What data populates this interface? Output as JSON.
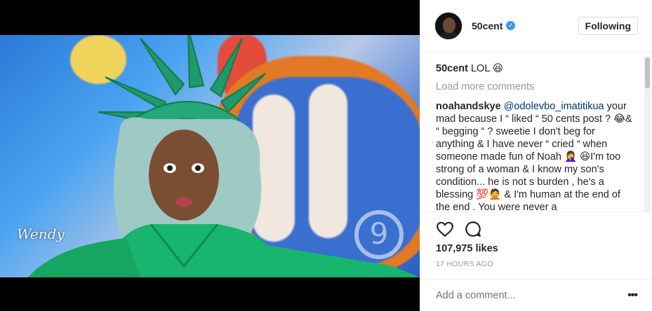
{
  "header": {
    "username": "50cent",
    "follow_label": "Following"
  },
  "caption": {
    "username": "50cent",
    "text": "LOL 😆"
  },
  "load_more_label": "Load more comments",
  "comment": {
    "username": "noahandskye",
    "mention": "@odolevbo_imatitikua",
    "text": "your mad because I “ liked “ 50 cents post ? 😂& “ begging “ ? sweetie I don't beg for anything & I have never “ cried “ when someone made fun of Noah 🤦‍♀️ 😆I'm too strong of a woman & I know my son's condition... he is not s burden , he's a blessing 💯🙅 & I'm human at the end of the end . You were never a"
  },
  "media": {
    "logo_text": "Wendy",
    "channel_number": "9"
  },
  "likes": "107,975 likes",
  "timestamp": "17 HOURS AGO",
  "add_comment_placeholder": "Add a comment...",
  "icons": {
    "like": "heart-icon",
    "comment": "comment-icon",
    "verified": "verified-badge-icon",
    "more": "more-options-icon"
  },
  "colors": {
    "verified_blue": "#3897f0",
    "muted_text": "#999999",
    "mention": "#003569"
  }
}
